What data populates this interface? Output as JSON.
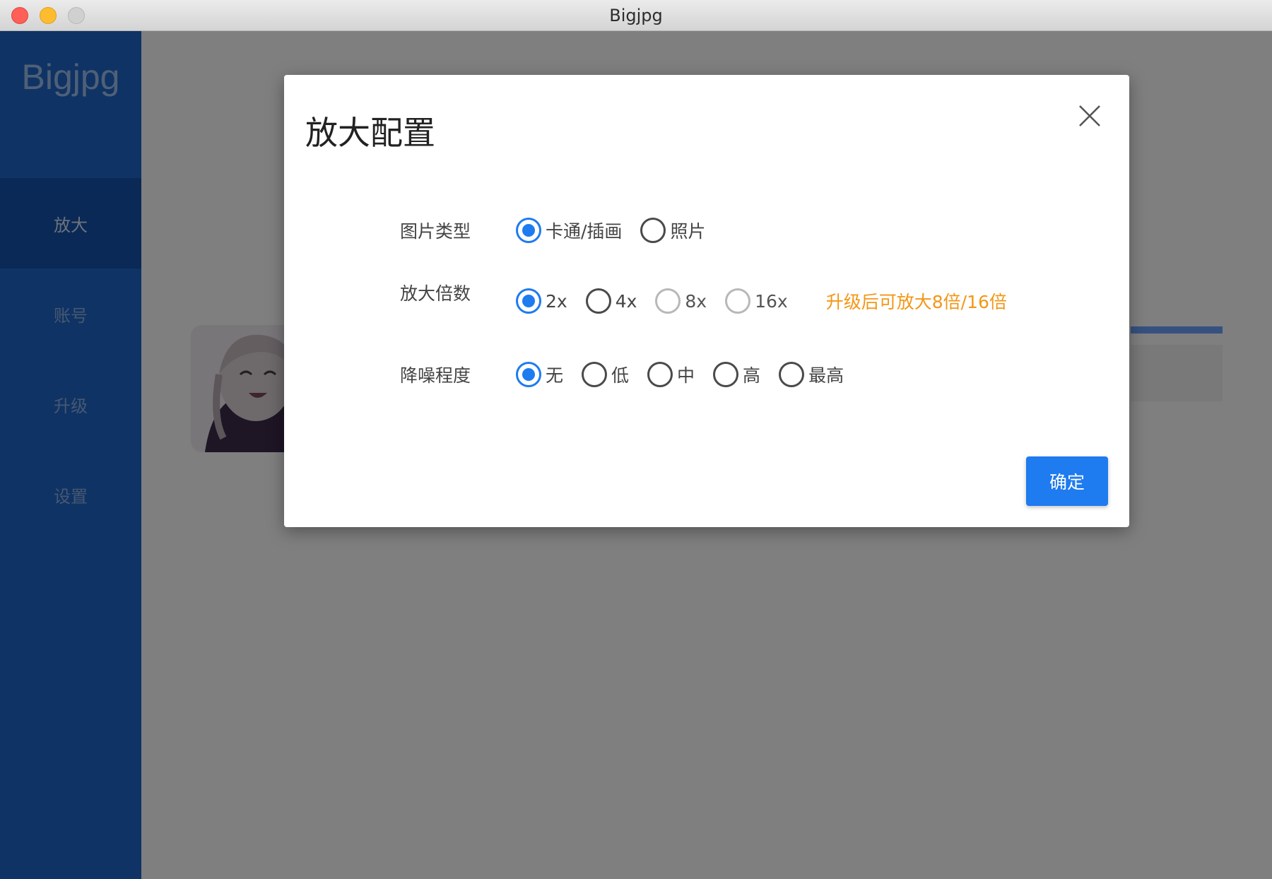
{
  "window": {
    "title": "Bigjpg"
  },
  "sidebar": {
    "brand": "Bigjpg",
    "items": [
      {
        "label": "放大",
        "active": true
      },
      {
        "label": "账号",
        "active": false
      },
      {
        "label": "升级",
        "active": false
      },
      {
        "label": "设置",
        "active": false
      }
    ]
  },
  "modal": {
    "title": "放大配置",
    "image_type": {
      "label": "图片类型",
      "options": [
        "卡通/插画",
        "照片"
      ],
      "selected": "卡通/插画"
    },
    "scale": {
      "label": "放大倍数",
      "options": [
        "2x",
        "4x",
        "8x",
        "16x"
      ],
      "selected": "2x",
      "disabled": [
        "8x",
        "16x"
      ],
      "note": "升级后可放大8倍/16倍"
    },
    "noise": {
      "label": "降噪程度",
      "options": [
        "无",
        "低",
        "中",
        "高",
        "最高"
      ],
      "selected": "无"
    },
    "confirm_label": "确定"
  },
  "colors": {
    "accent": "#1e7bf0",
    "sidebar": "#1f66c9",
    "sidebar_active": "#1552ad",
    "note": "#f39716"
  }
}
